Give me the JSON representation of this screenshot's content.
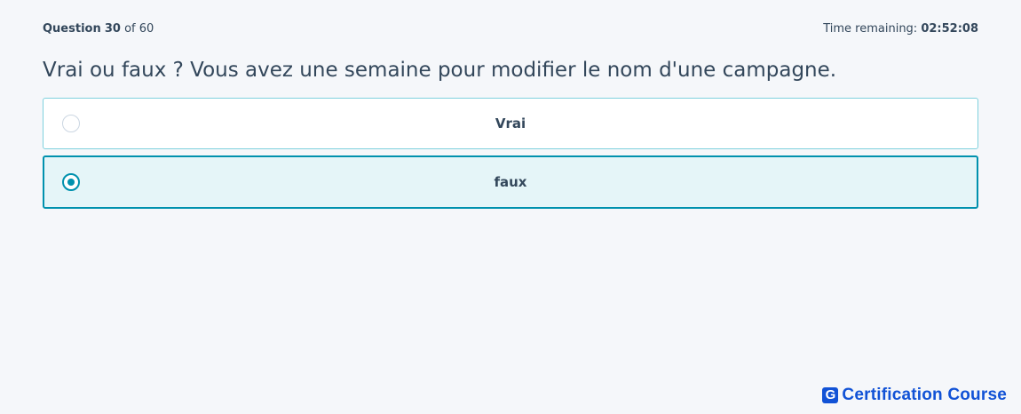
{
  "header": {
    "question_prefix": "Question",
    "question_number": "30",
    "question_of": "of 60",
    "time_label": "Time remaining:",
    "time_value": "02:52:08"
  },
  "question": {
    "text": "Vrai ou faux ? Vous avez une semaine pour modifier le nom d'une campagne."
  },
  "options": [
    {
      "label": "Vrai",
      "selected": false
    },
    {
      "label": "faux",
      "selected": true
    }
  ],
  "brand": {
    "mark": "G",
    "name": "Certification Course"
  },
  "colors": {
    "accent": "#0091ae",
    "selected_bg": "#e5f5f8",
    "brand": "#1152d6",
    "text": "#33475b"
  }
}
